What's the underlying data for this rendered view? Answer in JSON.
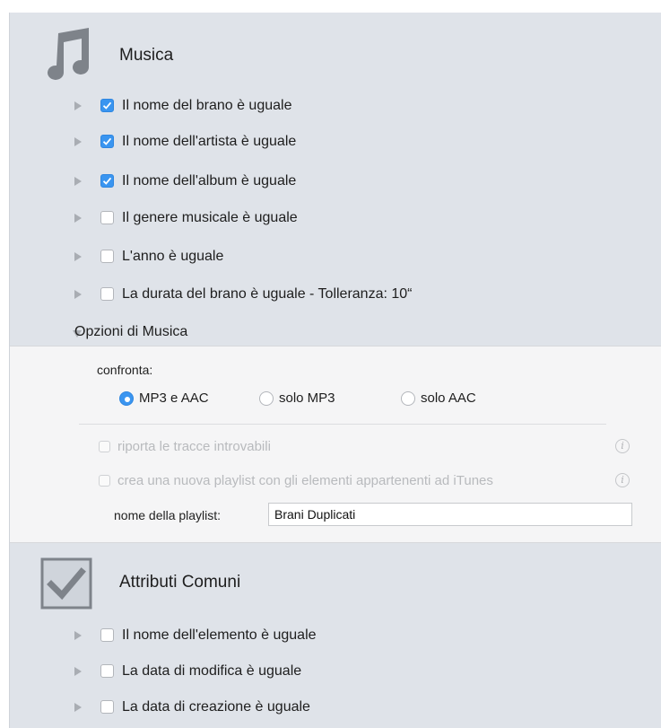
{
  "music": {
    "title": "Musica",
    "icon": "music-note-icon",
    "rows": [
      {
        "label": "Il nome del brano è uguale",
        "checked": true
      },
      {
        "label": "Il nome dell'artista è uguale",
        "checked": true
      },
      {
        "label": "Il nome dell'album è uguale",
        "checked": true
      },
      {
        "label": "Il genere musicale è uguale",
        "checked": false
      },
      {
        "label": "L'anno è uguale",
        "checked": false
      },
      {
        "label": "La durata del brano è uguale - Tolleranza: 10“",
        "checked": false
      }
    ],
    "options_label": "Opzioni di Musica"
  },
  "options": {
    "compare_label": "confronta:",
    "radios": [
      {
        "label": "MP3 e AAC",
        "selected": true
      },
      {
        "label": "solo MP3",
        "selected": false
      },
      {
        "label": "solo AAC",
        "selected": false
      }
    ],
    "report_missing": {
      "label": "riporta le tracce introvabili",
      "checked": false
    },
    "create_playlist": {
      "label": "crea una nuova playlist con gli elementi appartenenti ad iTunes",
      "checked": false
    },
    "info_glyph": "i",
    "playlist_name_label": "nome della playlist:",
    "playlist_name_value": "Brani Duplicati"
  },
  "common": {
    "title": "Attributi Comuni",
    "icon": "checkbox-check-icon",
    "rows": [
      {
        "label": "Il nome dell'elemento è uguale",
        "checked": false
      },
      {
        "label": "La data di modifica è uguale",
        "checked": false
      },
      {
        "label": "La data di creazione è uguale",
        "checked": false
      }
    ]
  },
  "colors": {
    "panel_bg": "#dfe3e9",
    "accent": "#3a95f0",
    "options_bg": "#f5f5f6"
  }
}
